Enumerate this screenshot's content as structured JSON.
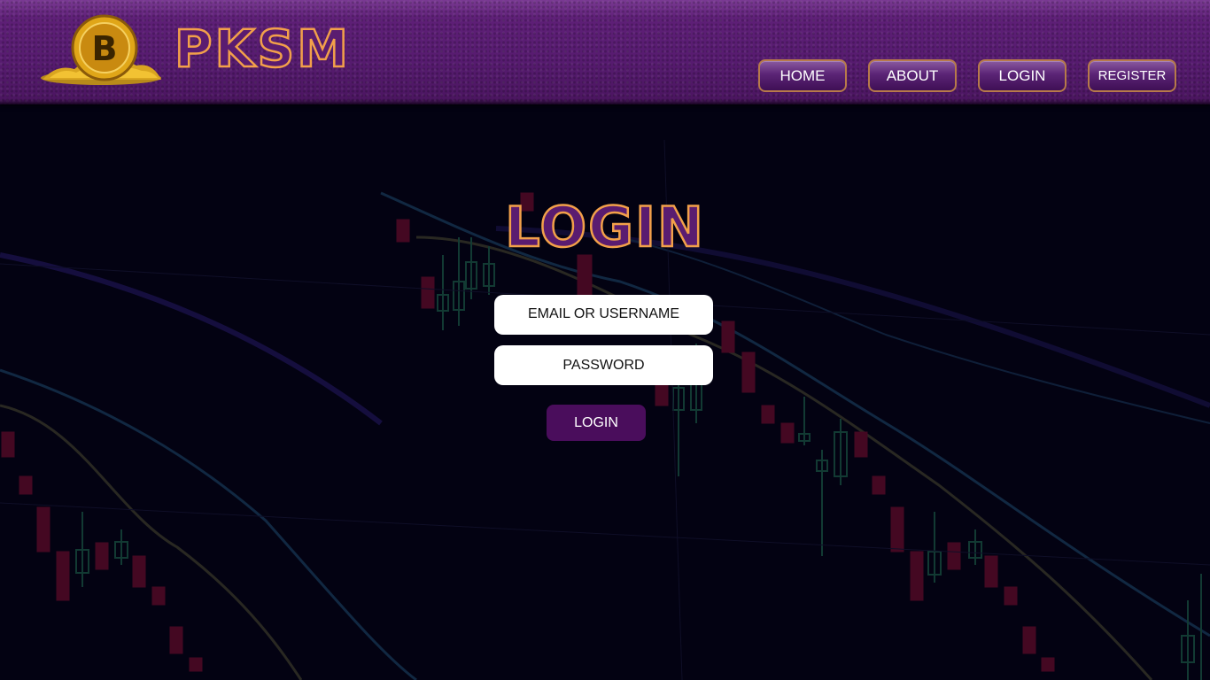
{
  "brand": {
    "name": "PKSM",
    "logo_icon": "bitcoin-gold-coin-icon",
    "logo_letter": "B"
  },
  "nav": {
    "home": "HOME",
    "about": "ABOUT",
    "login": "LOGIN",
    "register": "REGISTER"
  },
  "login_form": {
    "title": "LOGIN",
    "email_placeholder": "EMAIL OR USERNAME",
    "password_placeholder": "PASSWORD",
    "submit_label": "LOGIN"
  },
  "colors": {
    "header_purple": "#5e1f77",
    "accent_orange": "#f2a04a",
    "submit_purple": "#4a0d5c",
    "background": "#030212"
  }
}
